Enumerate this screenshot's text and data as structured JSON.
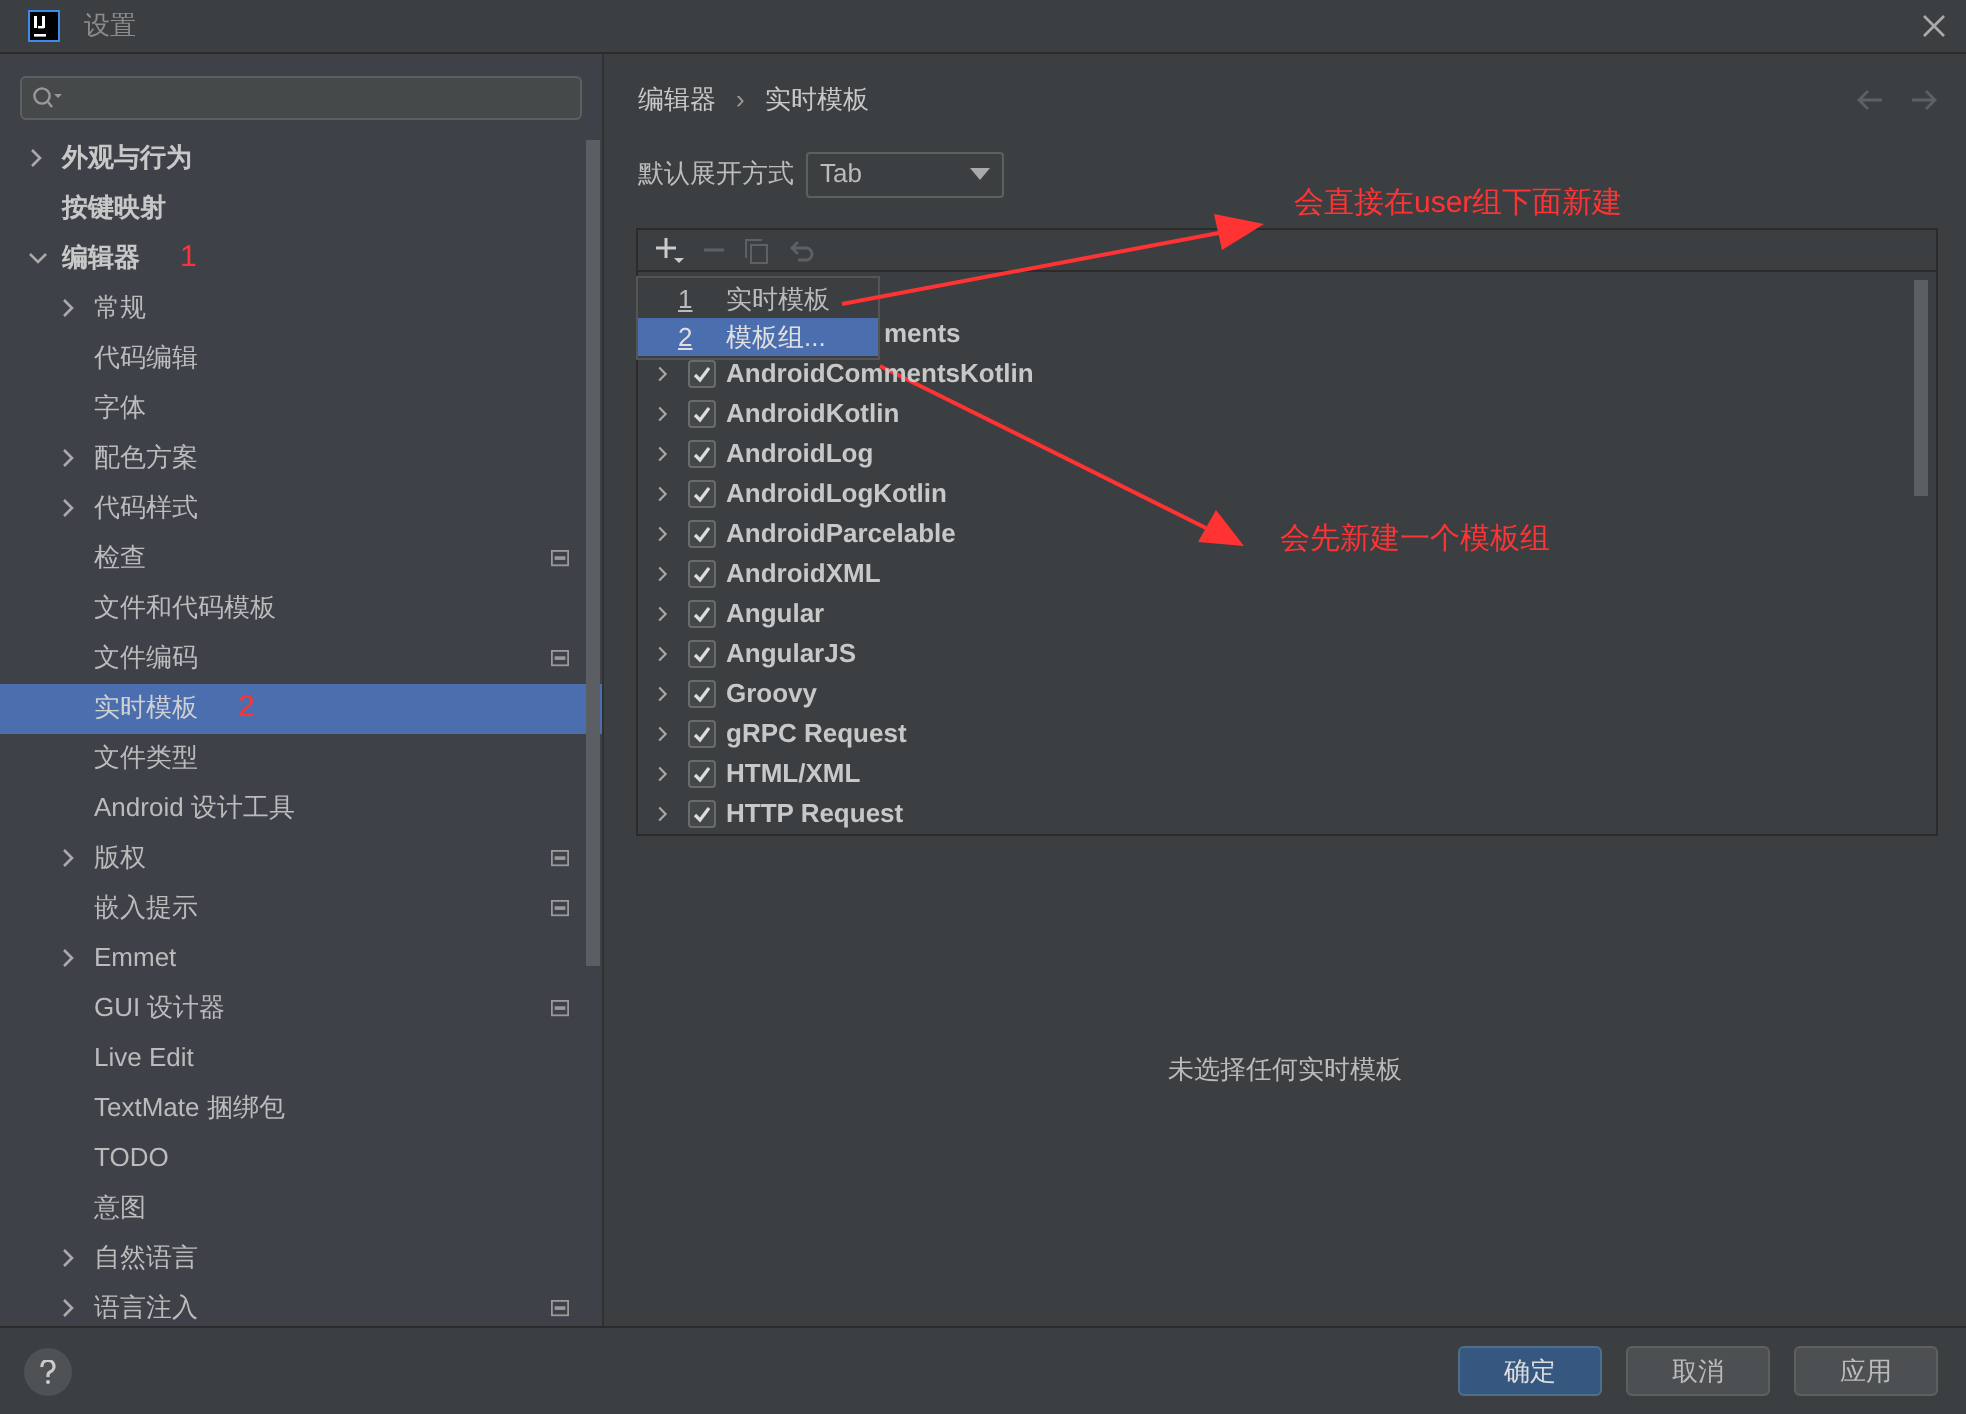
{
  "window": {
    "title": "设置"
  },
  "sidebar": {
    "items": [
      {
        "label": "外观与行为",
        "expanded": false,
        "selected": false
      },
      {
        "label": "按键映射",
        "selected": false
      },
      {
        "label": "编辑器",
        "expanded": true,
        "selected": false,
        "annotation": "1",
        "children": [
          {
            "label": "常规",
            "expanded": false,
            "selected": false
          },
          {
            "label": "代码编辑",
            "selected": false
          },
          {
            "label": "字体",
            "selected": false
          },
          {
            "label": "配色方案",
            "expanded": false,
            "selected": false
          },
          {
            "label": "代码样式",
            "expanded": false,
            "selected": false
          },
          {
            "label": "检查",
            "selected": false,
            "project_level": true
          },
          {
            "label": "文件和代码模板",
            "selected": false
          },
          {
            "label": "文件编码",
            "selected": false,
            "project_level": true
          },
          {
            "label": "实时模板",
            "selected": true,
            "annotation": "2"
          },
          {
            "label": "文件类型",
            "selected": false
          },
          {
            "label": "Android 设计工具",
            "selected": false
          },
          {
            "label": "版权",
            "expanded": false,
            "selected": false,
            "project_level": true
          },
          {
            "label": "嵌入提示",
            "selected": false,
            "project_level": true
          },
          {
            "label": "Emmet",
            "expanded": false,
            "selected": false
          },
          {
            "label": "GUI 设计器",
            "selected": false,
            "project_level": true
          },
          {
            "label": "Live Edit",
            "selected": false
          },
          {
            "label": "TextMate 捆绑包",
            "selected": false
          },
          {
            "label": "TODO",
            "selected": false
          },
          {
            "label": "意图",
            "selected": false
          },
          {
            "label": "自然语言",
            "expanded": false,
            "selected": false
          },
          {
            "label": "语言注入",
            "expanded": false,
            "selected": false,
            "project_level": true
          }
        ]
      }
    ]
  },
  "breadcrumb": [
    "编辑器",
    "›",
    "实时模板"
  ],
  "expand_setting": {
    "label": "默认展开方式",
    "value": "Tab"
  },
  "template_list": {
    "popup": [
      {
        "number": "1",
        "label": "实时模板",
        "selected": false
      },
      {
        "number": "2",
        "label": "模板组...",
        "selected": true
      }
    ],
    "rows": [
      {
        "label": "ments"
      },
      {
        "label": "AndroidCommentsKotlin",
        "checked": true
      },
      {
        "label": "AndroidKotlin",
        "checked": true
      },
      {
        "label": "AndroidLog",
        "checked": true
      },
      {
        "label": "AndroidLogKotlin",
        "checked": true
      },
      {
        "label": "AndroidParcelable",
        "checked": true
      },
      {
        "label": "AndroidXML",
        "checked": true
      },
      {
        "label": "Angular",
        "checked": true
      },
      {
        "label": "AngularJS",
        "checked": true
      },
      {
        "label": "Groovy",
        "checked": true
      },
      {
        "label": "gRPC Request",
        "checked": true
      },
      {
        "label": "HTML/XML",
        "checked": true
      },
      {
        "label": "HTTP Request",
        "checked": true
      }
    ]
  },
  "empty_message": "未选择任何实时模板",
  "annotations": [
    "会直接在user组下面新建",
    "会先新建一个模板组"
  ],
  "buttons": [
    {
      "label": "确定",
      "kind": "primary"
    },
    {
      "label": "取消",
      "kind": "normal"
    },
    {
      "label": "应用",
      "kind": "normal"
    }
  ]
}
